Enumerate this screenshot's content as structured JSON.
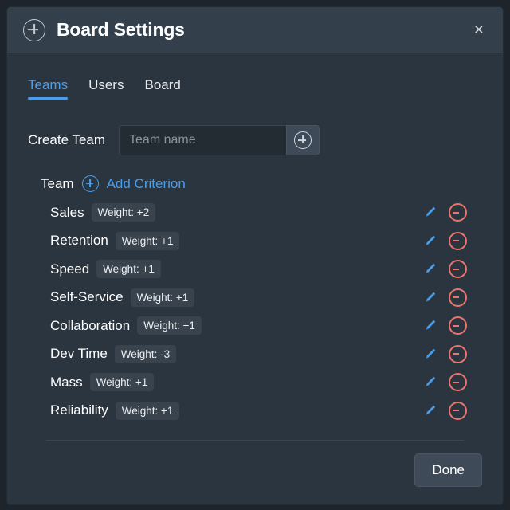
{
  "header": {
    "icon": "circle-plus-icon",
    "title": "Board Settings",
    "close_label": "×"
  },
  "tabs": [
    {
      "label": "Teams",
      "active": true
    },
    {
      "label": "Users",
      "active": false
    },
    {
      "label": "Board",
      "active": false
    }
  ],
  "create_team": {
    "label": "Create Team",
    "placeholder": "Team name",
    "value": "",
    "add_icon": "circle-plus-icon"
  },
  "team_section": {
    "label": "Team",
    "add_icon": "circle-plus-icon",
    "add_criterion_label": "Add Criterion"
  },
  "criteria": [
    {
      "name": "Sales",
      "weight": "Weight: +2"
    },
    {
      "name": "Retention",
      "weight": "Weight: +1"
    },
    {
      "name": "Speed",
      "weight": "Weight: +1"
    },
    {
      "name": "Self-Service",
      "weight": "Weight: +1"
    },
    {
      "name": "Collaboration",
      "weight": "Weight: +1"
    },
    {
      "name": "Dev Time",
      "weight": "Weight: -3"
    },
    {
      "name": "Mass",
      "weight": "Weight: +1"
    },
    {
      "name": "Reliability",
      "weight": "Weight: +1"
    }
  ],
  "row_actions": {
    "edit_icon": "pencil-icon",
    "delete_icon": "minus-circle-icon"
  },
  "footer": {
    "done_label": "Done"
  },
  "colors": {
    "accent_blue": "#4a9eea",
    "danger_red": "#e8766e",
    "modal_bg": "#2b3540",
    "header_bg": "#333f4b",
    "badge_bg": "#39434e",
    "button_bg": "#3e4a57"
  }
}
